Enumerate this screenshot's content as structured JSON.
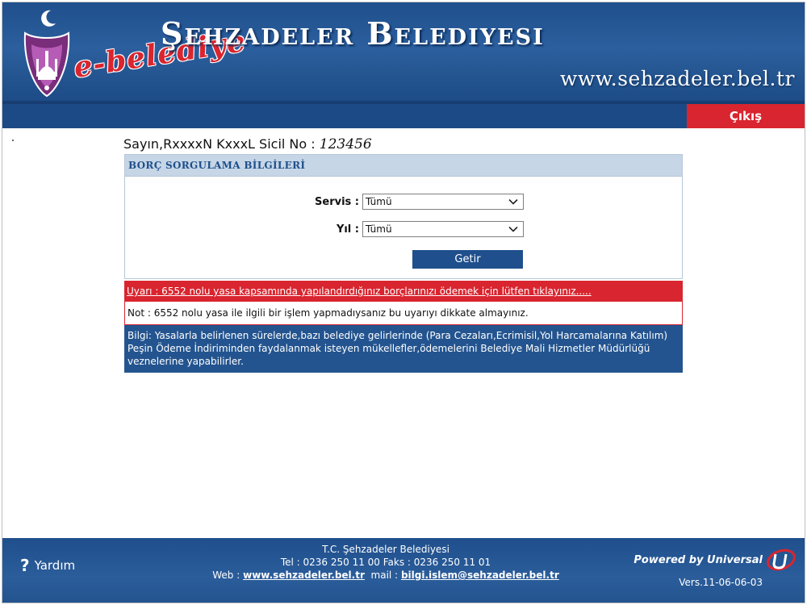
{
  "header": {
    "title": "Şehzadeler Belediyesi",
    "brand": "e-belediye",
    "url": "www.sehzadeler.bel.tr"
  },
  "nav": {
    "logout_label": "Çıkış"
  },
  "greeting": {
    "prefix": "Sayın,RxxxxN KxxxL Sicil No :",
    "sicil_no": "123456"
  },
  "panel": {
    "heading": "BORÇ SORGULAMA  BİLGİLERİ",
    "service": {
      "label": "Servis :",
      "value": "Tümü"
    },
    "year": {
      "label": "Yıl :",
      "value": "Tümü"
    },
    "submit_label": "Getir"
  },
  "warning": {
    "link_text": "Uyarı : 6552 nolu yasa kapsamında yapılandırdığınız borçlarınızı ödemek için lütfen tıklayınız....."
  },
  "note": {
    "text": "Not : 6552 nolu yasa ile ilgili bir işlem yapmadıysanız bu uyarıyı dikkate almayınız."
  },
  "info": {
    "text": "Bilgi: Yasalarla belirlenen sürelerde,bazı belediye gelirlerinde (Para Cezaları,Ecrimisil,Yol Harcamalarına Katılım) Peşin Ödeme İndiriminden faydalanmak isteyen mükellefler,ödemelerini Belediye Mali Hizmetler Müdürlüğü veznelerine yapabilirler."
  },
  "footer": {
    "help_label": "Yardım",
    "org": "T.C. Şehzadeler Belediyesi",
    "contact": "Tel : 0236 250 11 00  Faks : 0236 250 11 01",
    "web_label": "Web :",
    "web_link": "www.sehzadeler.bel.tr",
    "mail_label": "mail :",
    "mail_link": "bilgi.islem@sehzadeler.bel.tr",
    "powered": "Powered by Universal",
    "version": "Vers.11-06-06-03"
  },
  "colors": {
    "primary_blue": "#1f4f8c",
    "accent_red": "#d9252f",
    "panel_head": "#c6d6e6"
  },
  "icons": {
    "logout": "none",
    "help": "question-mark-icon",
    "select": "chevron-down-icon",
    "brand": "municipality-logo"
  }
}
